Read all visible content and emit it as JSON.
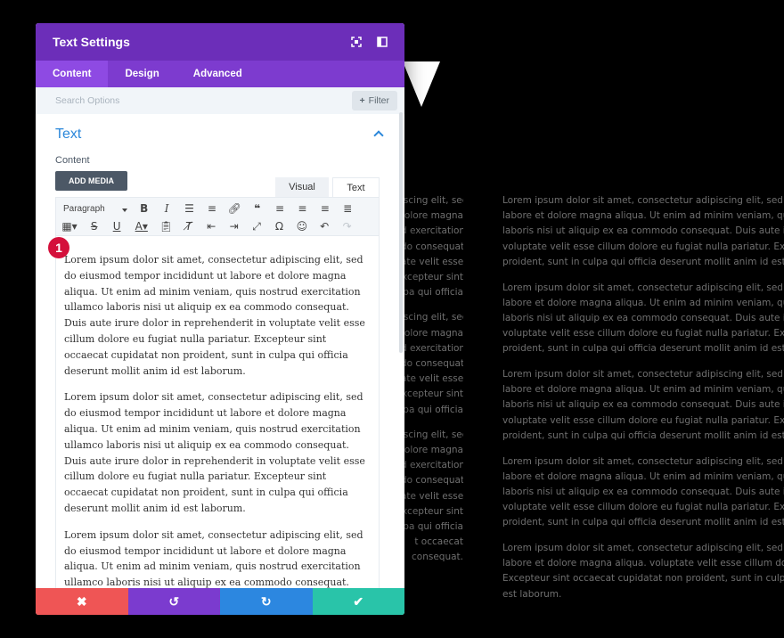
{
  "modal": {
    "title": "Text Settings",
    "tabs": [
      "Content",
      "Design",
      "Advanced"
    ],
    "search_placeholder": "Search Options",
    "filter_label": "Filter",
    "section_title": "Text",
    "content_label": "Content",
    "add_media_label": "ADD MEDIA",
    "editor_tabs": [
      "Visual",
      "Text"
    ],
    "format_select": "Paragraph",
    "step_badge": "1",
    "paragraphs": [
      "Lorem ipsum dolor sit amet, consectetur adipiscing elit, sed do eiusmod tempor incididunt ut labore et dolore magna aliqua. Ut enim ad minim veniam, quis nostrud exercitation ullamco laboris nisi ut aliquip ex ea commodo consequat. Duis aute irure dolor in reprehenderit in voluptate velit esse cillum dolore eu fugiat nulla pariatur. Excepteur sint occaecat cupidatat non proident, sunt in culpa qui officia deserunt mollit anim id est laborum.",
      "Lorem ipsum dolor sit amet, consectetur adipiscing elit, sed do eiusmod tempor incididunt ut labore et dolore magna aliqua. Ut enim ad minim veniam, quis nostrud exercitation ullamco laboris nisi ut aliquip ex ea commodo consequat. Duis aute irure dolor in reprehenderit in voluptate velit esse cillum dolore eu fugiat nulla pariatur. Excepteur sint occaecat cupidatat non proident, sunt in culpa qui officia deserunt mollit anim id est laborum.",
      "Lorem ipsum dolor sit amet, consectetur adipiscing elit, sed do eiusmod tempor incididunt ut labore et dolore magna aliqua. Ut enim ad minim veniam, quis nostrud exercitation ullamco laboris nisi ut aliquip ex ea commodo consequat. Duis aute irure dolor in reprehenderit in voluptate velit esse cillum dolore eu fugiat nulla pariatur. Excepteur sint occaecat cupidatat non proident, sunt in"
    ],
    "colors": {
      "header": "#6c2eb9",
      "tabs": "#7d3bcf",
      "close": "#ef5555",
      "undo": "#7b3bcf",
      "redo": "#2c87e0",
      "save": "#29c4a9",
      "accent": "#2b87da",
      "badge": "#d4103b"
    }
  },
  "background": {
    "mid_blocks": [
      [
        "iscing elit, sed",
        "olore magna",
        "d exercitation",
        "do consequat.",
        "ate velit esse",
        "xcepteur sint",
        "pa qui officia"
      ],
      [
        "iscing elit, sed",
        "olore magna",
        "d exercitation",
        "do consequat.",
        "ate velit esse",
        "xcepteur sint",
        "pa qui officia"
      ],
      [
        "iscing elit, sed",
        "olore magna",
        "d exercitation",
        "do consequat.",
        "ate velit esse",
        "xcepteur sint",
        "pa qui officia",
        "t occaecat",
        "consequat."
      ]
    ],
    "right_paragraphs": [
      [
        "Lorem ipsum dolor sit amet, consectetur adipiscing elit, sed do eiusmod",
        "labore et dolore magna aliqua. Ut enim ad minim veniam, quis nostrud",
        "laboris nisi ut aliquip ex ea commodo consequat. Duis aute irure dolor in",
        "voluptate velit esse cillum dolore eu fugiat nulla pariatur. Excepteur sint",
        "proident, sunt in culpa qui officia deserunt mollit anim id est laborum."
      ],
      [
        "Lorem ipsum dolor sit amet, consectetur adipiscing elit, sed do eiusmod",
        "labore et dolore magna aliqua. Ut enim ad minim veniam, quis nostrud",
        "laboris nisi ut aliquip ex ea commodo consequat. Duis aute irure dolor in",
        "voluptate velit esse cillum dolore eu fugiat nulla pariatur. Excepteur sint",
        "proident, sunt in culpa qui officia deserunt mollit anim id est laborum."
      ],
      [
        "Lorem ipsum dolor sit amet, consectetur adipiscing elit, sed do eiusmod",
        "labore et dolore magna aliqua. Ut enim ad minim veniam, quis nostrud",
        "laboris nisi ut aliquip ex ea commodo consequat. Duis aute irure dolor in",
        "voluptate velit esse cillum dolore eu fugiat nulla pariatur. Excepteur sint",
        "proident, sunt in culpa qui officia deserunt mollit anim id est laborum."
      ],
      [
        "Lorem ipsum dolor sit amet, consectetur adipiscing elit, sed do eiusmod",
        "labore et dolore magna aliqua. Ut enim ad minim veniam, quis nostrud",
        "laboris nisi ut aliquip ex ea commodo consequat. Duis aute irure dolor in",
        "voluptate velit esse cillum dolore eu fugiat nulla pariatur. Excepteur sint",
        "proident, sunt in culpa qui officia deserunt mollit anim id est laborum."
      ],
      [
        "Lorem ipsum dolor sit amet, consectetur adipiscing elit, sed do eiusmod",
        "labore et dolore magna aliqua. voluptate velit esse cillum dolore eu fugiat",
        "Excepteur sint occaecat cupidatat non proident, sunt in culpa qui officia",
        "est laborum."
      ]
    ]
  }
}
